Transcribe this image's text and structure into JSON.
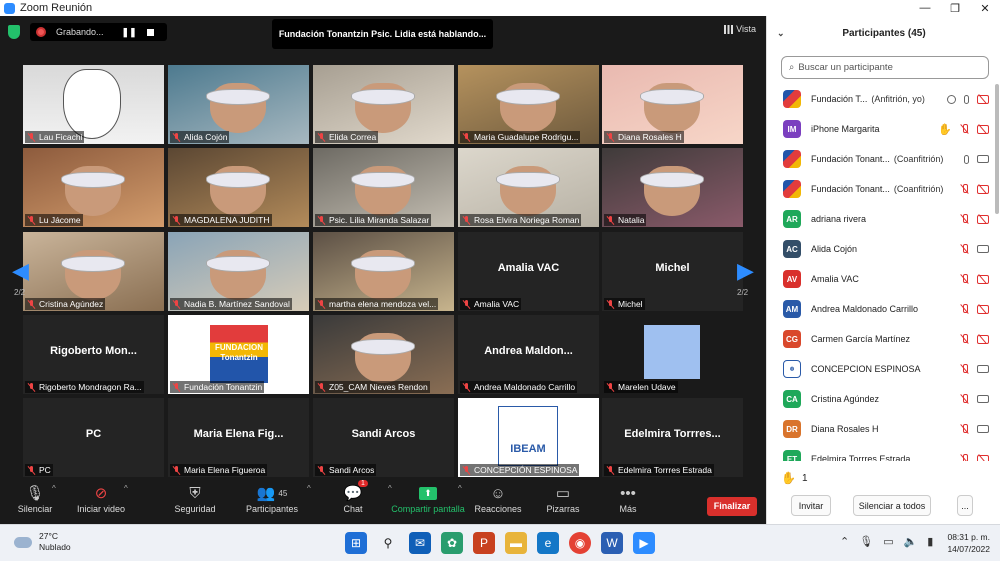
{
  "window": {
    "title": "Zoom Reunión"
  },
  "topbar": {
    "recording_label": "Grabando...",
    "speaking_banner": "Fundación Tonantzin Psic. Lidia está hablando...",
    "view_label": "Vista"
  },
  "gallery": {
    "page_left": "2/2",
    "page_right": "2/2",
    "tiles": [
      {
        "label": "Lau Ficachi",
        "big": "",
        "video": true
      },
      {
        "label": "Alida Cojón",
        "big": "",
        "video": true
      },
      {
        "label": "Elida Correa",
        "big": "",
        "video": true
      },
      {
        "label": "Maria Guadalupe Rodrigu...",
        "big": "",
        "video": true
      },
      {
        "label": "Diana Rosales H",
        "big": "",
        "video": true
      },
      {
        "label": "Lu Jácome",
        "big": "",
        "video": true
      },
      {
        "label": "MAGDALENA JUDITH",
        "big": "",
        "video": true
      },
      {
        "label": "Psic. Lilia Miranda Salazar",
        "big": "",
        "video": true
      },
      {
        "label": "Rosa Elvira Noriega Roman",
        "big": "",
        "video": true
      },
      {
        "label": "Natalia",
        "big": "",
        "video": true
      },
      {
        "label": "Cristina Agúndez",
        "big": "",
        "video": true
      },
      {
        "label": "Nadia B. Martínez Sandoval",
        "big": "",
        "video": true
      },
      {
        "label": "martha elena mendoza vel...",
        "big": "",
        "video": true
      },
      {
        "label": "Amalia VAC",
        "big": "Amalia VAC",
        "video": false
      },
      {
        "label": "Michel",
        "big": "Michel",
        "video": false
      },
      {
        "label": "Rigoberto Mondragon Ra...",
        "big": "Rigoberto Mon...",
        "video": false
      },
      {
        "label": "Fundación Tonantzin",
        "big": "",
        "video": true
      },
      {
        "label": "Z05_CAM Nieves Rendon",
        "big": "",
        "video": true
      },
      {
        "label": "Andrea Maldonado Carrillo",
        "big": "Andrea Maldon...",
        "video": false
      },
      {
        "label": "Marelen Udave",
        "big": "",
        "video": true
      },
      {
        "label": "PC",
        "big": "PC",
        "video": false
      },
      {
        "label": "Maria Elena Figueroa",
        "big": "Maria Elena Fig...",
        "video": false
      },
      {
        "label": "Sandi Arcos",
        "big": "Sandi Arcos",
        "video": false
      },
      {
        "label": "CONCEPCIÓN ESPINOSA",
        "big": "",
        "video": true
      },
      {
        "label": "Edelmira Torrres Estrada",
        "big": "Edelmira Torrres...",
        "video": false
      }
    ],
    "logo_text": "FUNDACION Tonantzin",
    "ibeam_text": "IBEAM"
  },
  "toolbar": {
    "mute": "Silenciar",
    "video": "Iniciar video",
    "security": "Seguridad",
    "participants": "Participantes",
    "participants_count": "45",
    "chat": "Chat",
    "chat_badge": "1",
    "share": "Compartir pantalla",
    "reactions": "Reacciones",
    "whiteboards": "Pizarras",
    "more": "Más",
    "end": "Finalizar",
    "share_color": "#23c16b",
    "end_color": "#d9302c"
  },
  "panel": {
    "title": "Participantes (45)",
    "search_placeholder": "Buscar un participante",
    "participants": [
      {
        "initials": "",
        "avatar": "logo",
        "name": "Fundación T...",
        "role": "(Anfitrión, yo)",
        "hand": false,
        "mic": "on",
        "cam": "off",
        "rec": true
      },
      {
        "initials": "IM",
        "avatar": "#7b3fbf",
        "name": "iPhone Margarita",
        "role": "",
        "hand": true,
        "mic": "off",
        "cam": "off",
        "rec": false
      },
      {
        "initials": "",
        "avatar": "logo",
        "name": "Fundación Tonant...",
        "role": "(Coanfitrión)",
        "hand": false,
        "mic": "on",
        "cam": "on",
        "rec": false
      },
      {
        "initials": "",
        "avatar": "logo",
        "name": "Fundación Tonant...",
        "role": "(Coanfitrión)",
        "hand": false,
        "mic": "off",
        "cam": "off",
        "rec": false
      },
      {
        "initials": "AR",
        "avatar": "#1fa85a",
        "name": "adriana rivera",
        "role": "",
        "hand": false,
        "mic": "off",
        "cam": "off",
        "rec": false
      },
      {
        "initials": "AC",
        "avatar": "#334e68",
        "name": "Alida Cojón",
        "role": "",
        "hand": false,
        "mic": "off",
        "cam": "on",
        "rec": false
      },
      {
        "initials": "AV",
        "avatar": "#d9302c",
        "name": "Amalia VAC",
        "role": "",
        "hand": false,
        "mic": "off",
        "cam": "off",
        "rec": false
      },
      {
        "initials": "AM",
        "avatar": "#2a5aa8",
        "name": "Andrea Maldonado Carrillo",
        "role": "",
        "hand": false,
        "mic": "off",
        "cam": "off",
        "rec": false
      },
      {
        "initials": "CG",
        "avatar": "#d9482c",
        "name": "Carmen García Martínez",
        "role": "",
        "hand": false,
        "mic": "off",
        "cam": "off",
        "rec": false
      },
      {
        "initials": "",
        "avatar": "ibeam",
        "name": "CONCEPCION ESPINOSA",
        "role": "",
        "hand": false,
        "mic": "off",
        "cam": "on",
        "rec": false
      },
      {
        "initials": "CA",
        "avatar": "#1fa85a",
        "name": "Cristina Agúndez",
        "role": "",
        "hand": false,
        "mic": "off",
        "cam": "on",
        "rec": false
      },
      {
        "initials": "DR",
        "avatar": "#d9742c",
        "name": "Diana Rosales H",
        "role": "",
        "hand": false,
        "mic": "off",
        "cam": "on",
        "rec": false
      },
      {
        "initials": "ET",
        "avatar": "#1fa85a",
        "name": "Edelmira Torrres Estrada",
        "role": "",
        "hand": false,
        "mic": "off",
        "cam": "off",
        "rec": false
      }
    ],
    "hand_count": "1",
    "invite": "Invitar",
    "mute_all": "Silenciar a todos",
    "more": "..."
  },
  "taskbar": {
    "temperature": "27°C",
    "weather": "Nublado",
    "time": "08:31 p. m.",
    "date": "14/07/2022"
  }
}
